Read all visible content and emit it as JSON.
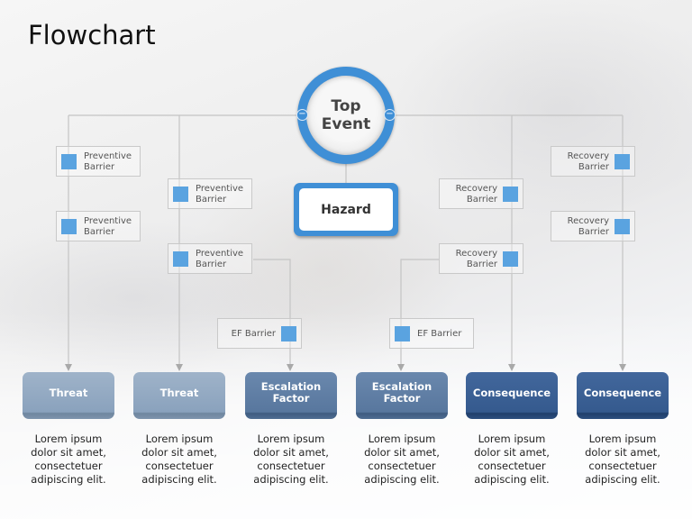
{
  "title": "Flowchart",
  "top_event": {
    "label_line1": "Top",
    "label_line2": "Event",
    "left_knob": "−",
    "right_knob": "−"
  },
  "hazard": {
    "label": "Hazard"
  },
  "barriers": {
    "preventive": [
      {
        "line1": "Preventive",
        "line2": "Barrier"
      },
      {
        "line1": "Preventive",
        "line2": "Barrier"
      },
      {
        "line1": "Preventive",
        "line2": "Barrier"
      },
      {
        "line1": "Preventive",
        "line2": "Barrier"
      }
    ],
    "recovery": [
      {
        "line1": "Recovery",
        "line2": "Barrier"
      },
      {
        "line1": "Recovery",
        "line2": "Barrier"
      },
      {
        "line1": "Recovery",
        "line2": "Barrier"
      },
      {
        "line1": "Recovery",
        "line2": "Barrier"
      }
    ],
    "ef": [
      {
        "label": "EF Barrier"
      },
      {
        "label": "EF Barrier"
      }
    ]
  },
  "nodes": [
    {
      "line1": "Threat",
      "line2": "",
      "type": "threat"
    },
    {
      "line1": "Threat",
      "line2": "",
      "type": "threat"
    },
    {
      "line1": "Escalation",
      "line2": "Factor",
      "type": "escalation"
    },
    {
      "line1": "Escalation",
      "line2": "Factor",
      "type": "escalation"
    },
    {
      "line1": "Consequence",
      "line2": "",
      "type": "consequence"
    },
    {
      "line1": "Consequence",
      "line2": "",
      "type": "consequence"
    }
  ],
  "descriptions": [
    {
      "l1": "Lorem ipsum",
      "l2": "dolor sit amet,",
      "l3": "consectetuer",
      "l4": "adipiscing elit."
    },
    {
      "l1": "Lorem ipsum",
      "l2": "dolor sit amet,",
      "l3": "consectetuer",
      "l4": "adipiscing elit."
    },
    {
      "l1": "Lorem ipsum",
      "l2": "dolor sit amet,",
      "l3": "consectetuer",
      "l4": "adipiscing elit."
    },
    {
      "l1": "Lorem ipsum",
      "l2": "dolor sit amet,",
      "l3": "consectetuer",
      "l4": "adipiscing elit."
    },
    {
      "l1": "Lorem ipsum",
      "l2": "dolor sit amet,",
      "l3": "consectetuer",
      "l4": "adipiscing elit."
    },
    {
      "l1": "Lorem ipsum",
      "l2": "dolor sit amet,",
      "l3": "consectetuer",
      "l4": "adipiscing elit."
    }
  ],
  "colors": {
    "accent_blue": "#3f8fd6",
    "barrier_square": "#5aa3e0",
    "threat": "#8aa2bd",
    "escalation": "#58779e",
    "consequence": "#355a8e"
  }
}
